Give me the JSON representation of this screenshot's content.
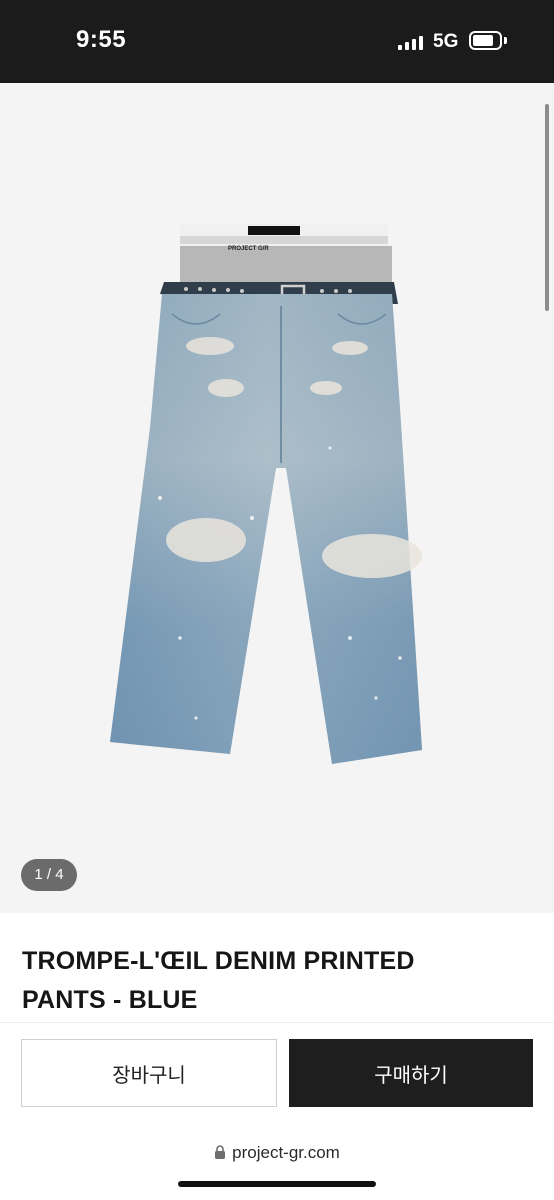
{
  "status_bar": {
    "time": "9:55",
    "network": "5G",
    "signal_bars": 4,
    "battery_level": 0.65
  },
  "gallery": {
    "image_description_icon": "jeans-product-photo",
    "counter": "1 / 4"
  },
  "product": {
    "title_line1": "TROMPE-L'ŒIL DENIM PRINTED",
    "title_line2": "PANTS - BLUE",
    "image_label": "PROJECT G/R"
  },
  "actions": {
    "cart_label": "장바구니",
    "buy_label": "구매하기"
  },
  "browser": {
    "url": "project-gr.com"
  },
  "colors": {
    "status_bg": "#1b1b1b",
    "gallery_bg": "#f4f4f4",
    "buy_bg": "#1e1e1e",
    "denim": "#7e9fb9"
  }
}
